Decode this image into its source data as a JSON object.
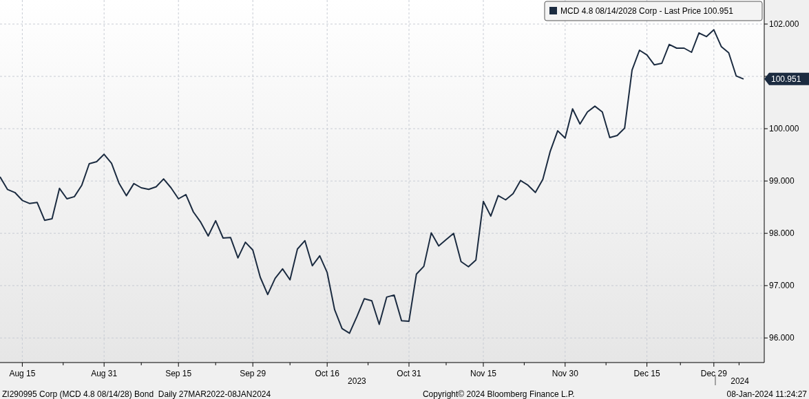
{
  "chart": {
    "chart_data": {
      "type": "line",
      "ylim": [
        95.53,
        102.46
      ],
      "categories": [
        null,
        null,
        null,
        "Aug 15",
        null,
        null,
        null,
        null,
        null,
        null,
        null,
        null,
        null,
        null,
        "Aug 31",
        null,
        null,
        null,
        null,
        null,
        null,
        null,
        null,
        null,
        "Sep 15",
        null,
        null,
        null,
        null,
        null,
        null,
        null,
        null,
        null,
        "Sep 29",
        null,
        null,
        null,
        null,
        null,
        null,
        null,
        null,
        null,
        "Oct 16",
        null,
        null,
        null,
        null,
        null,
        null,
        null,
        null,
        null,
        null,
        "Oct 31",
        null,
        null,
        null,
        null,
        null,
        null,
        null,
        null,
        null,
        "Nov 15",
        null,
        null,
        null,
        null,
        null,
        null,
        null,
        null,
        null,
        null,
        "Nov 30",
        null,
        null,
        null,
        null,
        null,
        null,
        null,
        null,
        null,
        null,
        "Dec 15",
        null,
        null,
        null,
        null,
        null,
        null,
        null,
        null,
        "Dec 29",
        null,
        null,
        null,
        null
      ],
      "series": [
        {
          "name": "MCD 4.8 08/14/2028 Corp - Last Price 100.951",
          "color": "#1b2b40",
          "values": [
            99.08,
            98.84,
            98.78,
            98.63,
            98.57,
            98.59,
            98.25,
            98.28,
            98.86,
            98.66,
            98.7,
            98.92,
            99.33,
            99.37,
            99.51,
            99.34,
            98.96,
            98.72,
            98.95,
            98.87,
            98.84,
            98.89,
            99.04,
            98.87,
            98.66,
            98.74,
            98.41,
            98.21,
            97.95,
            98.24,
            97.91,
            97.92,
            97.53,
            97.83,
            97.68,
            97.16,
            96.83,
            97.14,
            97.32,
            97.11,
            97.7,
            97.86,
            97.38,
            97.57,
            97.25,
            96.54,
            96.18,
            96.09,
            96.41,
            96.75,
            96.71,
            96.26,
            96.78,
            96.82,
            96.33,
            96.32,
            97.22,
            97.37,
            98.01,
            97.76,
            97.88,
            98.0,
            97.46,
            97.36,
            97.49,
            98.61,
            98.33,
            98.72,
            98.64,
            98.76,
            99.01,
            98.92,
            98.78,
            99.03,
            99.57,
            99.96,
            99.82,
            100.38,
            100.09,
            100.32,
            100.43,
            100.32,
            99.83,
            99.87,
            100.01,
            101.12,
            101.5,
            101.41,
            101.22,
            101.25,
            101.61,
            101.54,
            101.54,
            101.46,
            101.83,
            101.76,
            101.89,
            101.57,
            101.45,
            101.01,
            100.95
          ]
        }
      ],
      "yticks": [
        {
          "value": 102,
          "label": "102.000"
        },
        {
          "value": 100,
          "label": "100.000"
        },
        {
          "value": 99,
          "label": "99.000"
        },
        {
          "value": 98,
          "label": "98.000"
        },
        {
          "value": 97,
          "label": "97.000"
        },
        {
          "value": 96,
          "label": "96.000"
        }
      ],
      "annotations": [
        "100.951"
      ],
      "grid": true
    },
    "year_labels": [
      {
        "label": "2023"
      },
      {
        "label": "2024"
      }
    ]
  },
  "footer": {
    "left": "ZI290995 Corp (MCD 4.8 08/14/28) Bond  Daily 27MAR2022-08JAN2024",
    "center": "Copyright© 2024 Bloomberg Finance L.P.",
    "right": "08-Jan-2024 11:24:27"
  }
}
